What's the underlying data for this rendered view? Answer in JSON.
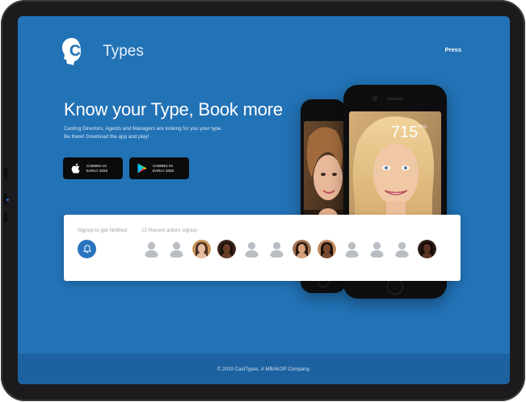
{
  "brand": {
    "name_bold": "Cast",
    "name_light": "Types"
  },
  "nav": {
    "press_label": "Press"
  },
  "hero": {
    "title": "Know your Type, Book more",
    "subtitle_line1": "Casting Directors, Agents and Managers are looking for you your type.",
    "subtitle_line2": "Be there! Download the app and play!"
  },
  "stores": [
    {
      "icon": "apple-icon",
      "line1": "COMING IN",
      "line2": "EARLY 2020"
    },
    {
      "icon": "google-play-icon",
      "line1": "COMING IN",
      "line2": "EARLY 2020"
    }
  ],
  "phone": {
    "score": "715",
    "score_unit": "PTS"
  },
  "signup": {
    "notify_label": "Signup to get Notified",
    "recent_label": "12 Recent actors signup",
    "avatars": [
      "blank",
      "blank",
      "photo",
      "photo",
      "blank",
      "blank",
      "photo",
      "photo",
      "blank",
      "blank",
      "blank",
      "photo"
    ]
  },
  "footer": {
    "copyright": "© 2019 CastTypes. A MBAKOP Company."
  },
  "colors": {
    "background": "#2272b6",
    "footer": "#1d62a0",
    "accent": "#2a74bf"
  }
}
